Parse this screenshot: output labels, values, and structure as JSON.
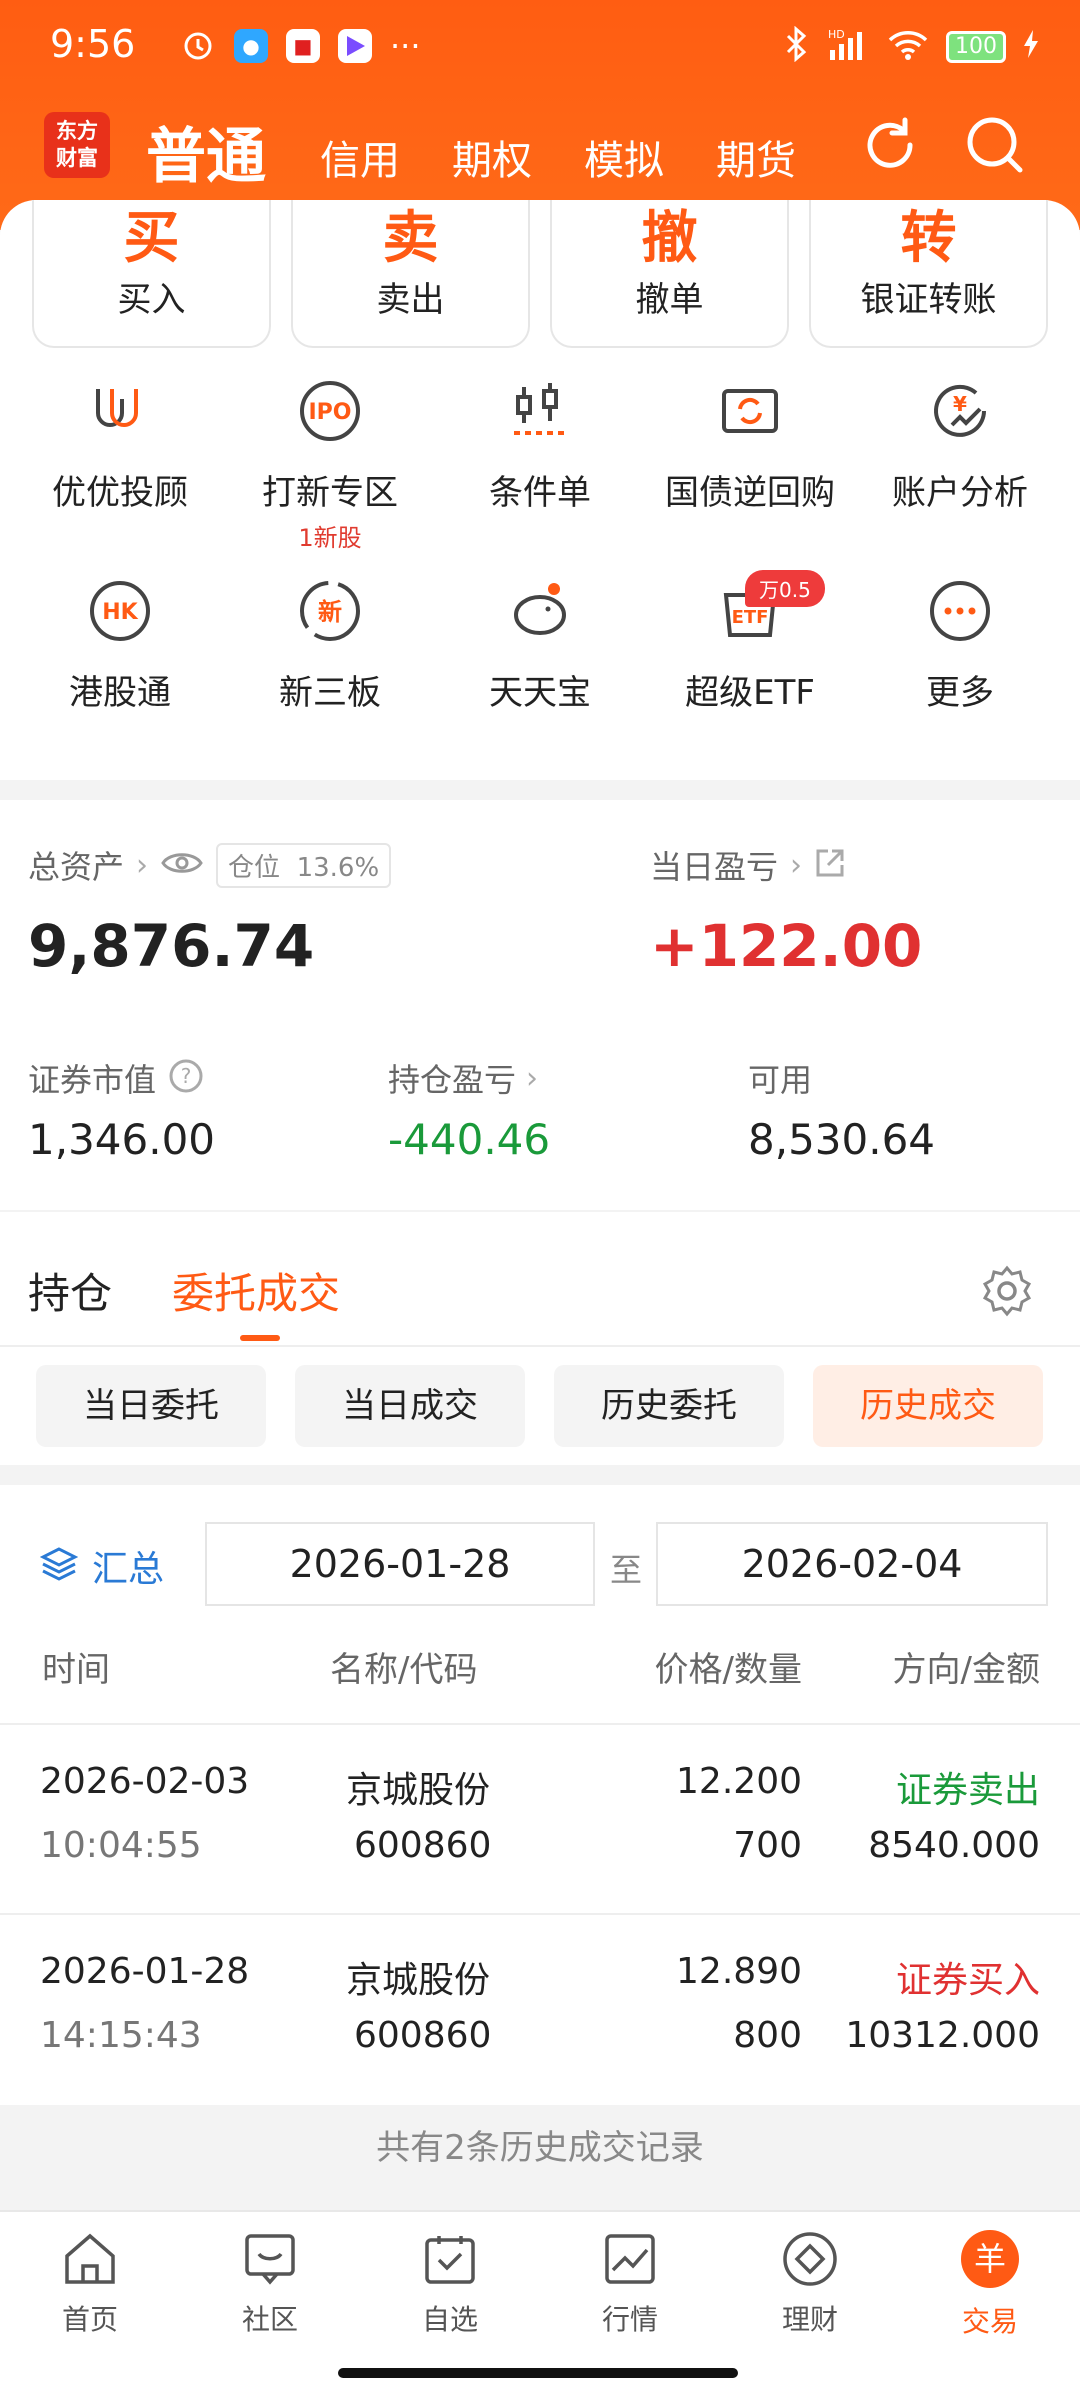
{
  "status": {
    "time": "9:56",
    "battery": "100",
    "dots": "···",
    "net": "HD"
  },
  "logo": {
    "line1": "东方",
    "line2": "财富"
  },
  "nav": {
    "tabs": [
      "普通",
      "信用",
      "期权",
      "模拟",
      "期货"
    ]
  },
  "quick": [
    {
      "big": "买",
      "label": "买入"
    },
    {
      "big": "卖",
      "label": "卖出"
    },
    {
      "big": "撤",
      "label": "撤单"
    },
    {
      "big": "转",
      "label": "银证转账"
    }
  ],
  "grid": [
    {
      "label": "优优投顾",
      "icon": "uu-advisor-icon"
    },
    {
      "label": "打新专区",
      "icon": "ipo-icon",
      "sub": "1新股"
    },
    {
      "label": "条件单",
      "icon": "conditional-order-icon"
    },
    {
      "label": "国债逆回购",
      "icon": "repo-icon"
    },
    {
      "label": "账户分析",
      "icon": "account-analysis-icon"
    },
    {
      "label": "港股通",
      "icon": "hk-connect-icon"
    },
    {
      "label": "新三板",
      "icon": "neeq-icon"
    },
    {
      "label": "天天宝",
      "icon": "piggy-bank-icon"
    },
    {
      "label": "超级ETF",
      "icon": "etf-icon",
      "badge": "万0.5"
    },
    {
      "label": "更多",
      "icon": "more-icon"
    }
  ],
  "assets": {
    "total_label": "总资产",
    "position_label": "仓位",
    "position_value": "13.6%",
    "total_value": "9,876.74",
    "daily_pl_label": "当日盈亏",
    "daily_pl_value": "+122.00",
    "market_value_label": "证券市值",
    "market_value": "1,346.00",
    "holding_pl_label": "持仓盈亏",
    "holding_pl_value": "-440.46",
    "available_label": "可用",
    "available_value": "8,530.64"
  },
  "tabs": {
    "holdings": "持仓",
    "orders": "委托成交"
  },
  "subtabs": [
    "当日委托",
    "当日成交",
    "历史委托",
    "历史成交"
  ],
  "filter": {
    "summary": "汇总",
    "from": "2026-01-28",
    "to_label": "至",
    "to": "2026-02-04"
  },
  "table": {
    "headers": [
      "时间",
      "名称/代码",
      "价格/数量",
      "方向/金额"
    ],
    "rows": [
      {
        "date": "2026-02-03",
        "time": "10:04:55",
        "name": "京城股份",
        "code": "600860",
        "price": "12.200",
        "qty": "700",
        "direction": "证券卖出",
        "amount": "8540.000",
        "dir_color": "#1a9a3a"
      },
      {
        "date": "2026-01-28",
        "time": "14:15:43",
        "name": "京城股份",
        "code": "600860",
        "price": "12.890",
        "qty": "800",
        "direction": "证券买入",
        "amount": "10312.000",
        "dir_color": "#e03131"
      }
    ]
  },
  "footer_note": "共有2条历史成交记录",
  "bottom_nav": [
    {
      "label": "首页",
      "icon": "home-icon"
    },
    {
      "label": "社区",
      "icon": "community-icon"
    },
    {
      "label": "自选",
      "icon": "watchlist-icon"
    },
    {
      "label": "行情",
      "icon": "market-icon"
    },
    {
      "label": "理财",
      "icon": "wealth-icon"
    },
    {
      "label": "交易",
      "icon": "trade-icon",
      "glyph": "羊"
    }
  ],
  "colors": {
    "accent": "#ff5a14",
    "up": "#e03131",
    "down": "#1a9a3a"
  }
}
